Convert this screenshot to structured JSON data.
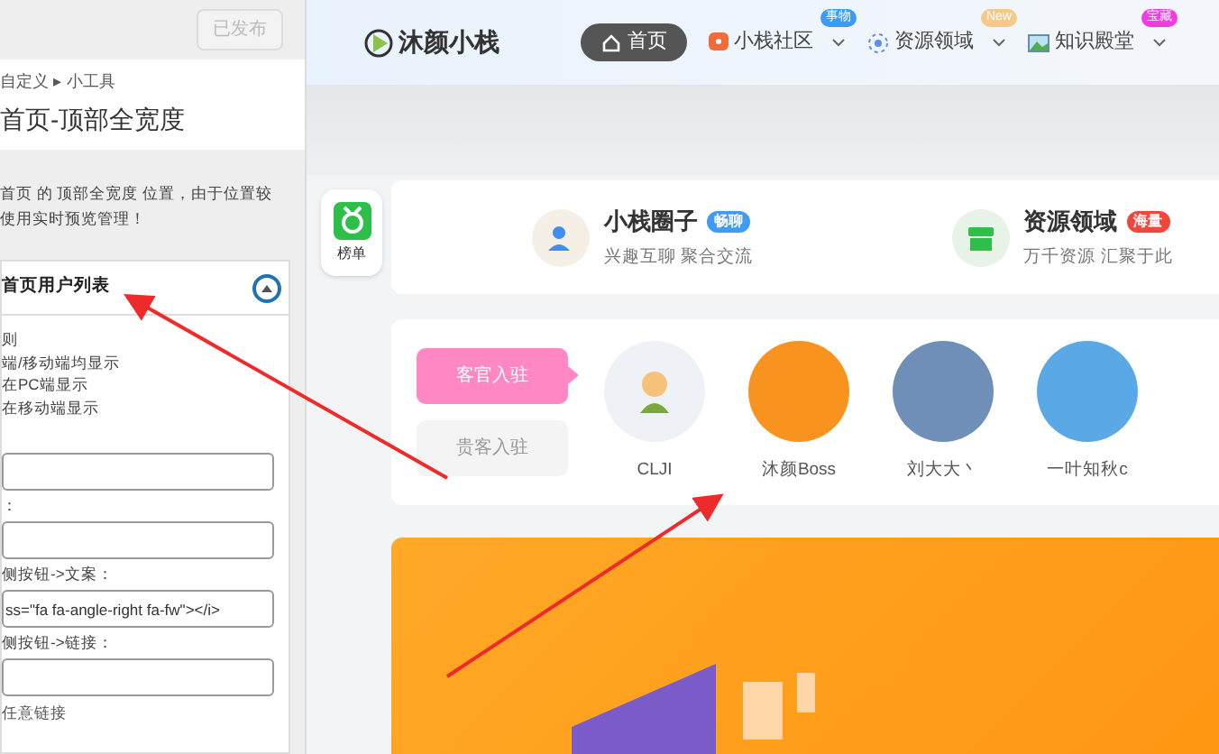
{
  "customizer": {
    "publish_button": {
      "label": "已发布",
      "disabled": true
    },
    "breadcrumb": "自定义 ▸ 小工具",
    "title": "首页-顶部全宽度",
    "description": [
      "首页 的 顶部全宽度 位置，由于位置较",
      "使用实时预览管理！"
    ],
    "widget": {
      "title": "首页用户列表",
      "expanded": true,
      "options": [
        "则",
        "端/移动端均显示",
        "在PC端显示",
        "在移动端显示"
      ],
      "fields": [
        {
          "kind": "input"
        },
        {
          "kind": "input",
          "label": "："
        },
        {
          "kind": "input",
          "label": "侧按钮->文案：",
          "value": "ss=\"fa fa-angle-right fa-fw\"></i>"
        },
        {
          "kind": "input",
          "label": "侧按钮->链接："
        }
      ],
      "hint": "任意链接"
    }
  },
  "site": {
    "logo": "沐颜小栈",
    "nav": [
      {
        "label": "首页",
        "selected": true
      },
      {
        "label": "小栈社区",
        "selected": false,
        "badge": "事物",
        "color": "#3b9cf5"
      },
      {
        "label": "资源领域",
        "selected": false,
        "badge": "New",
        "color": "#f5c98a"
      },
      {
        "label": "知识殿堂",
        "selected": false,
        "badge": "宝藏",
        "color": "#f03ce0"
      }
    ],
    "side_button": "榜单",
    "features": [
      {
        "title": "小栈圈子",
        "badge": "畅聊",
        "color": "#3f9cf6",
        "subtitle": "兴趣互聊 聚合交流"
      },
      {
        "title": "资源领域",
        "badge": "海量",
        "color": "#f2453d",
        "subtitle": "万千资源 汇聚于此"
      }
    ],
    "user_tabs": [
      {
        "label": "客官入驻",
        "selected": true
      },
      {
        "label": "贵客入驻",
        "selected": false
      }
    ],
    "users": [
      {
        "name": "CLJI",
        "color": "#eef1f5"
      },
      {
        "name": "沐颜Boss",
        "color": "#f7931e"
      },
      {
        "name": "刘大大丶",
        "color": "#6f8fb8"
      },
      {
        "name": "一叶知秋c",
        "color": "#5aa9e6"
      }
    ]
  }
}
